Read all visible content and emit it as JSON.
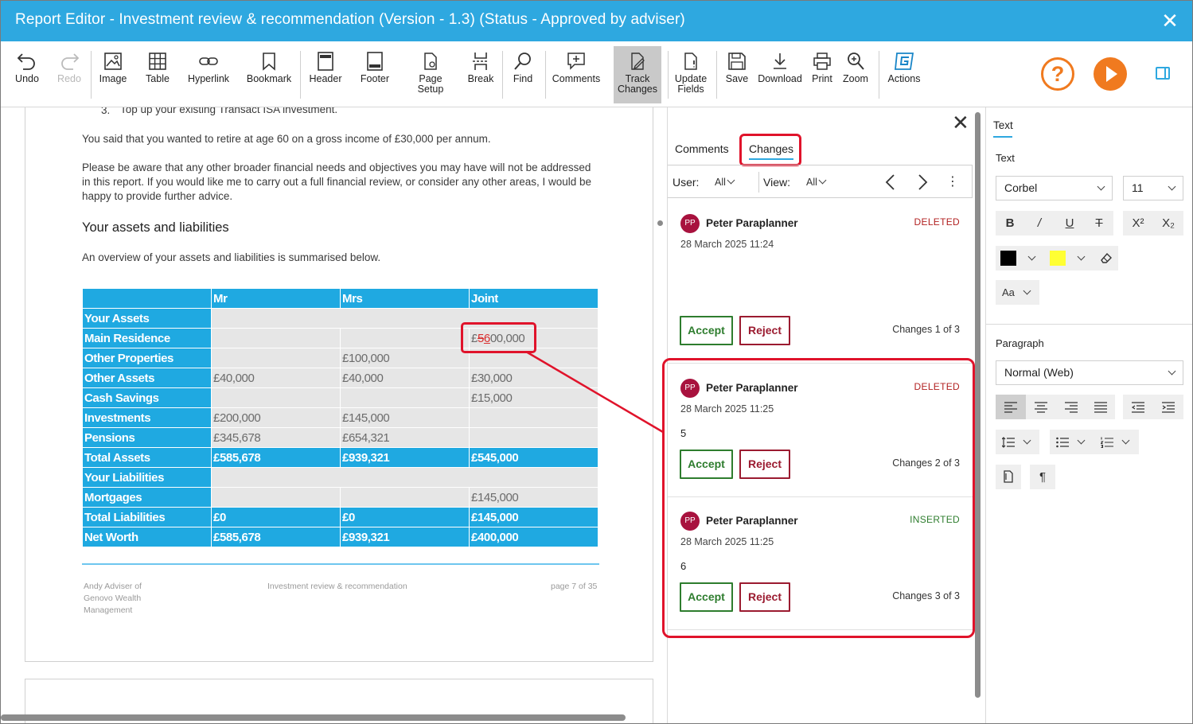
{
  "window": {
    "title": "Report Editor - Investment review & recommendation (Version - 1.3) (Status - Approved by adviser)",
    "close_glyph": "✕"
  },
  "toolbar": {
    "undo": "Undo",
    "redo": "Redo",
    "image": "Image",
    "table": "Table",
    "hyperlink": "Hyperlink",
    "bookmark": "Bookmark",
    "header": "Header",
    "footer": "Footer",
    "page_setup_1": "Page",
    "page_setup_2": "Setup",
    "break": "Break",
    "find": "Find",
    "comments": "Comments",
    "track_1": "Track",
    "track_2": "Changes",
    "update_1": "Update",
    "update_2": "Fields",
    "save": "Save",
    "download": "Download",
    "print": "Print",
    "zoom": "Zoom",
    "actions": "Actions",
    "help_glyph": "?",
    "accent_color": "#f07a1f"
  },
  "document": {
    "list_item_num": "3.",
    "list_item": "Top up your existing Transact ISA investment.",
    "para1": "You said that you wanted to retire at age 60 on a gross income of £30,000 per annum.",
    "para2_l1": "Please be aware that any other broader financial needs and objectives you may have will not be addressed",
    "para2_l2": "in this report. If you would like me to carry out a full financial review, or consider any other areas, I would be",
    "para2_l3": "happy to provide further advice.",
    "heading": "Your assets and liabilities",
    "para3": "An overview of your assets and liabilities is summarised below.",
    "table": {
      "headers": [
        "",
        "Mr",
        "Mrs",
        "Joint"
      ],
      "rows": {
        "your_assets": "Your Assets",
        "main_residence": "Main Residence",
        "main_residence_joint_prefix": "£",
        "main_residence_joint_deleted": "5",
        "main_residence_joint_inserted": "6",
        "main_residence_joint_suffix": "00,000",
        "other_properties": [
          "Other Properties",
          "",
          "£100,000",
          ""
        ],
        "other_assets": [
          "Other Assets",
          "£40,000",
          "£40,000",
          "£30,000"
        ],
        "cash_savings": [
          "Cash Savings",
          "",
          "",
          "£15,000"
        ],
        "investments": [
          "Investments",
          "£200,000",
          "£145,000",
          ""
        ],
        "pensions": [
          "Pensions",
          "£345,678",
          "£654,321",
          ""
        ],
        "total_assets": [
          "Total Assets",
          "£585,678",
          "£939,321",
          "£545,000"
        ],
        "your_liabilities": "Your Liabilities",
        "mortgages": [
          "Mortgages",
          "",
          "",
          "£145,000"
        ],
        "total_liabilities": [
          "Total Liabilities",
          "£0",
          "£0",
          "£145,000"
        ],
        "net_worth": [
          "Net Worth",
          "£585,678",
          "£939,321",
          "£400,000"
        ]
      }
    },
    "footer": {
      "left_l1": "Andy Adviser of",
      "left_l2": "Genovo Wealth",
      "left_l3": "Management",
      "center": "Investment review & recommendation",
      "right": "page 7 of 35"
    }
  },
  "changes_panel": {
    "close_glyph": "✕",
    "tabs": {
      "comments": "Comments",
      "changes": "Changes"
    },
    "filter": {
      "user_label": "User:",
      "user_value": "All",
      "view_label": "View:",
      "view_value": "All",
      "more_glyph": "⋮"
    },
    "cards": [
      {
        "initials": "PP",
        "user": "Peter Paraplanner",
        "date": "28 March 2025 11:24",
        "type": "DELETED",
        "content": "",
        "accept": "Accept",
        "reject": "Reject",
        "count": "Changes 1 of 3"
      },
      {
        "initials": "PP",
        "user": "Peter Paraplanner",
        "date": "28 March 2025 11:25",
        "type": "DELETED",
        "content": "5",
        "accept": "Accept",
        "reject": "Reject",
        "count": "Changes 2 of 3"
      },
      {
        "initials": "PP",
        "user": "Peter Paraplanner",
        "date": "28 March 2025 11:25",
        "type": "INSERTED",
        "content": "6",
        "accept": "Accept",
        "reject": "Reject",
        "count": "Changes 3 of 3"
      }
    ]
  },
  "format_panel": {
    "tab": "Text",
    "text_section": "Text",
    "font": "Corbel",
    "size": "11",
    "bold": "B",
    "italic": "/",
    "underline": "U",
    "strike": "T",
    "superscript": "X²",
    "subscript": "X₂",
    "font_color": "#000000",
    "highlight_color": "#ffff33",
    "case": "Aa",
    "paragraph_section": "Paragraph",
    "style": "Normal (Web)",
    "pilcrow": "¶"
  }
}
